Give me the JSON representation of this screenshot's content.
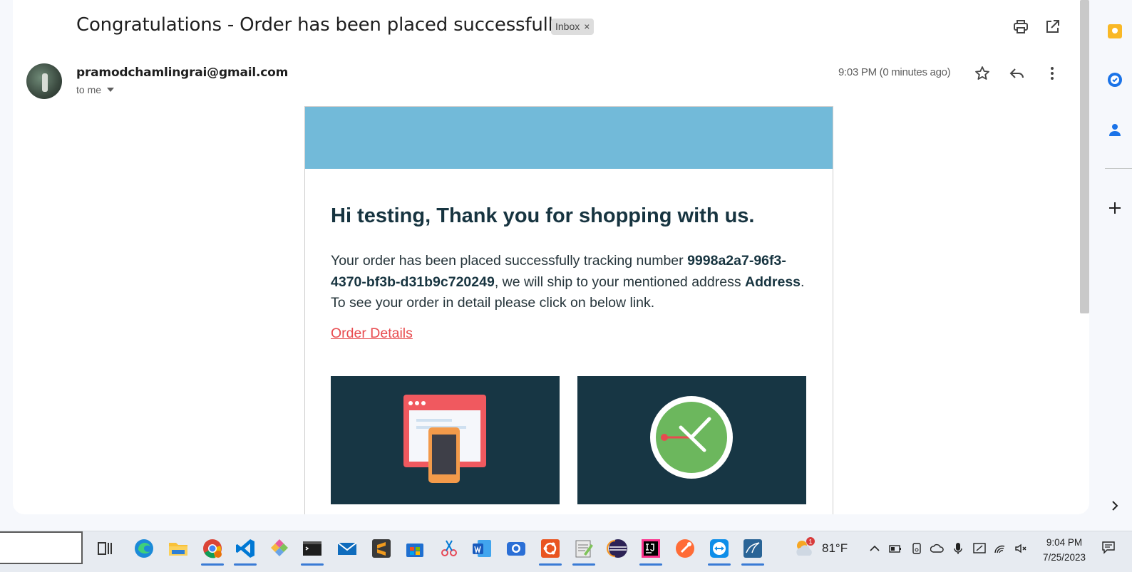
{
  "email": {
    "subject": "Congratulations - Order has been placed successfully",
    "label_chip": "Inbox",
    "label_close": "×",
    "sender": "pramodchamlingrai@gmail.com",
    "recipient": "to me",
    "timestamp": "9:03 PM (0 minutes ago)"
  },
  "body": {
    "greeting": "Hi testing, Thank you for shopping with us.",
    "text_1": "Your order has been placed successfully tracking number ",
    "tracking_number": "9998a2a7-96f3-4370-bf3b-d31b9c720249",
    "text_2": ", we will ship to your mentioned address ",
    "address": "Address",
    "text_3": ". To see your order in detail please click on below link.",
    "link_label": "Order Details"
  },
  "toolbar_icons": [
    "print-icon",
    "open-in-new-window-icon",
    "star-icon",
    "reply-icon",
    "more-options-icon"
  ],
  "side_panel_icons": [
    "keep-icon",
    "tasks-icon",
    "contacts-icon",
    "add-icon",
    "collapse-chevron-icon"
  ],
  "taskbar": {
    "apps": [
      "task-view-icon",
      "edge-icon",
      "file-explorer-icon",
      "chrome-icon",
      "vscode-icon",
      "app-icon",
      "terminal-icon",
      "mail-icon",
      "sublime-icon",
      "store-icon",
      "snipping-icon",
      "word-icon",
      "camera-icon",
      "ubuntu-icon",
      "notepad-icon",
      "eclipse-icon",
      "intellij-icon",
      "postman-icon",
      "teamviewer-icon",
      "mysql-workbench-icon"
    ],
    "weather_badge": "1",
    "temperature": "81°F",
    "time": "9:04 PM",
    "date": "7/25/2023"
  },
  "colors": {
    "banner": "#72bad9",
    "tile": "#173644",
    "link": "#e84b4f",
    "heading": "#173440"
  }
}
